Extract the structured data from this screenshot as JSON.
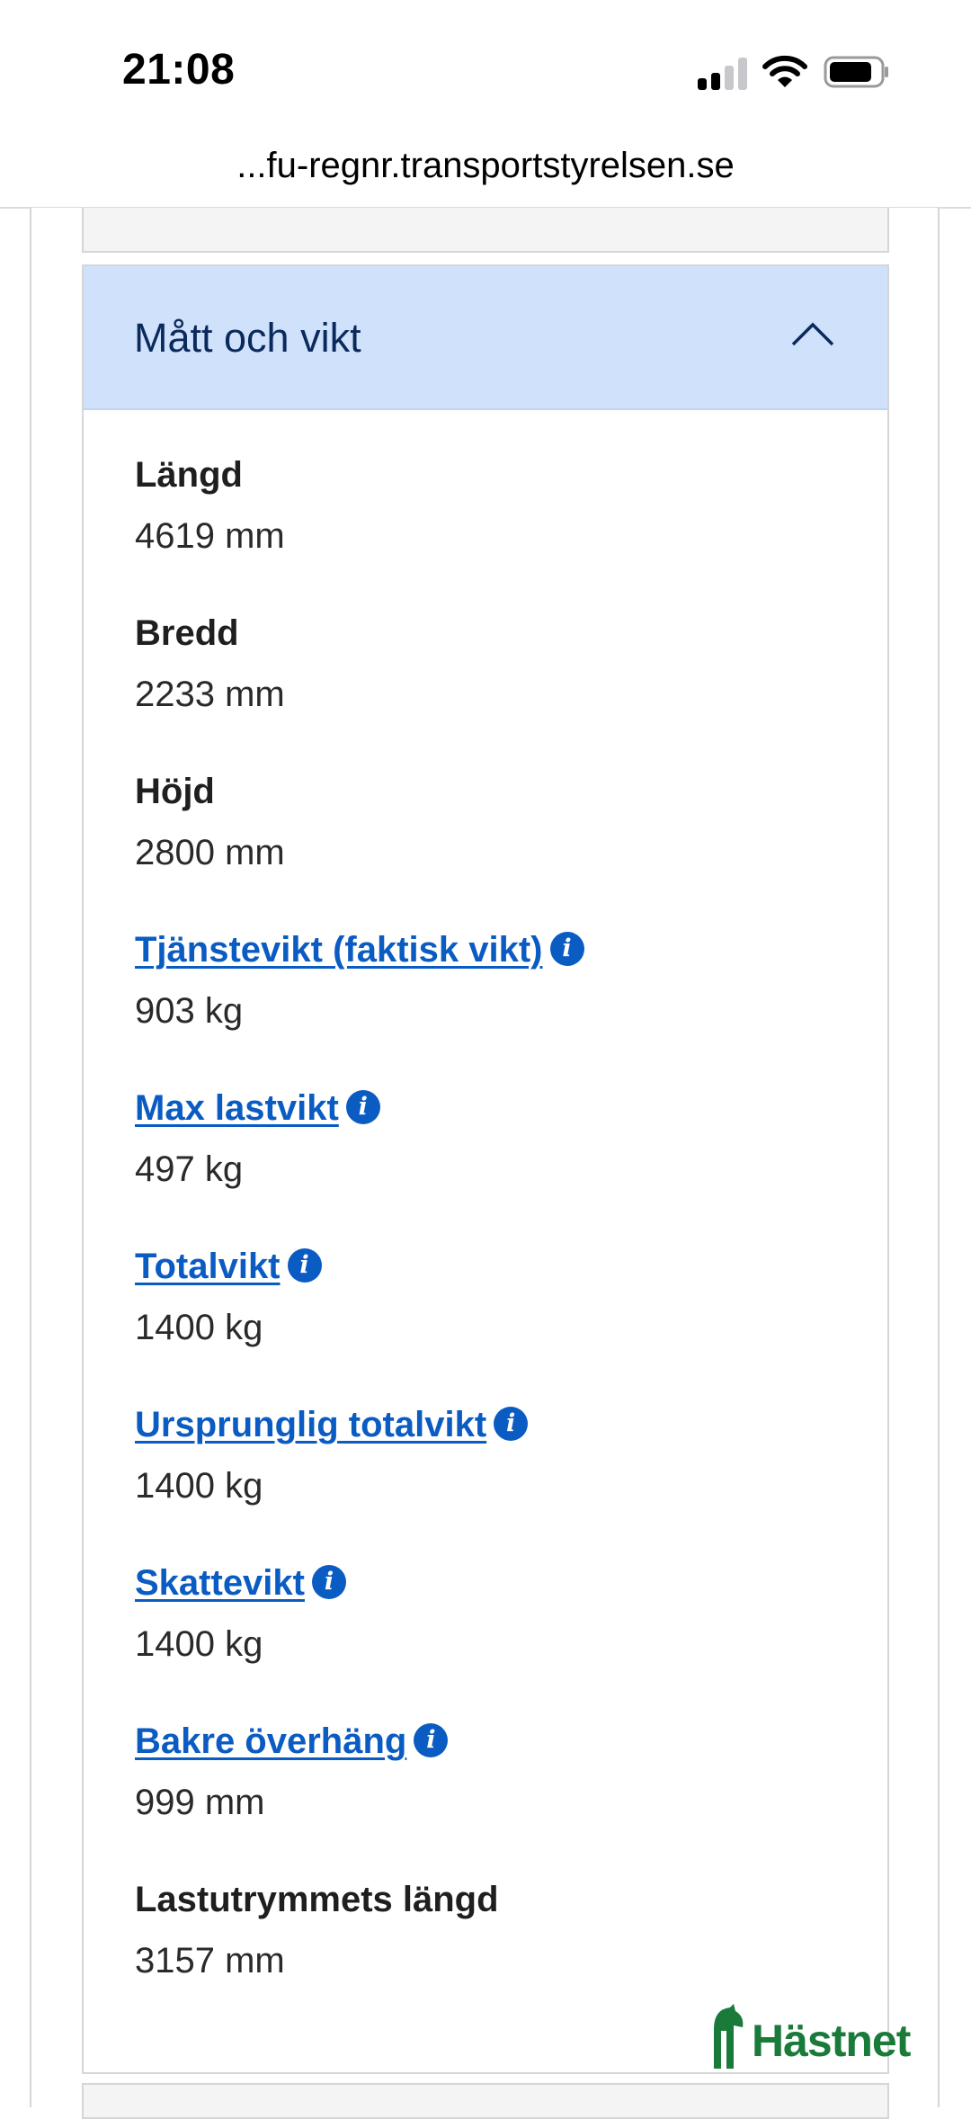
{
  "status_bar": {
    "time": "21:08"
  },
  "browser": {
    "url": "...fu-regnr.transportstyrelsen.se"
  },
  "section": {
    "title": "Mått och vikt",
    "expanded": true,
    "icon": "chevron-up-icon"
  },
  "fields": [
    {
      "label": "Längd",
      "value": "4619 mm",
      "is_link": false
    },
    {
      "label": "Bredd",
      "value": "2233 mm",
      "is_link": false
    },
    {
      "label": "Höjd",
      "value": "2800 mm",
      "is_link": false
    },
    {
      "label": "Tjänstevikt (faktisk vikt)",
      "value": "903 kg",
      "is_link": true
    },
    {
      "label": "Max lastvikt",
      "value": "497 kg",
      "is_link": true
    },
    {
      "label": "Totalvikt",
      "value": "1400 kg",
      "is_link": true
    },
    {
      "label": "Ursprunglig totalvikt",
      "value": "1400 kg",
      "is_link": true
    },
    {
      "label": "Skattevikt",
      "value": "1400 kg",
      "is_link": true
    },
    {
      "label": "Bakre överhäng",
      "value": "999 mm",
      "is_link": true
    },
    {
      "label": "Lastutrymmets längd",
      "value": "3157 mm",
      "is_link": false
    }
  ],
  "info_icon_glyph": "i",
  "watermark": {
    "text": "Hästnet"
  },
  "colors": {
    "header_bg": "#d0e1fb",
    "header_text": "#0b2a5c",
    "link": "#0b5cc2",
    "watermark": "#1a7a3a"
  }
}
